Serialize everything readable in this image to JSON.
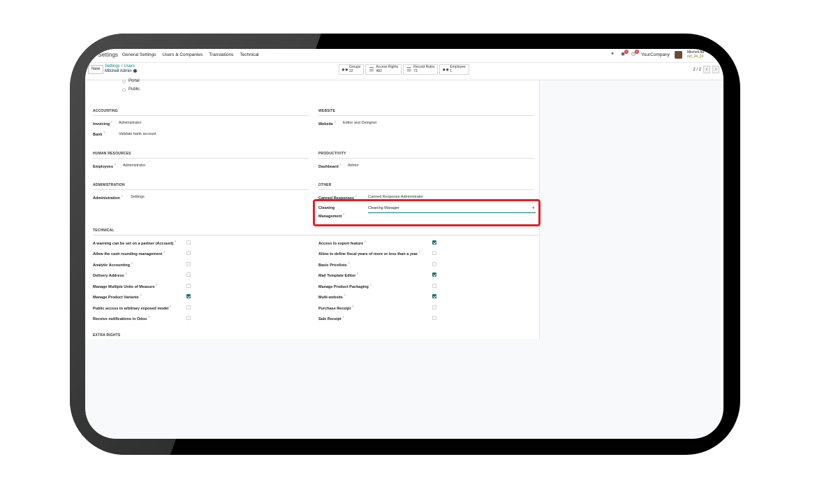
{
  "navbar": {
    "app_name": "Settings",
    "menu": [
      "General Settings",
      "Users & Companies",
      "Translations",
      "Technical"
    ],
    "chat_badge": "5",
    "activity_badge": "6",
    "company": "YourCompany",
    "user_name": "Mitchell Ad",
    "user_db": "oct_24_23"
  },
  "control": {
    "new_label": "New",
    "breadcrumb_parent": "Settings",
    "breadcrumb_sep": "/",
    "breadcrumb_child": "Users",
    "record_name": "Mitchell Admin",
    "stats": [
      {
        "label": "Groups",
        "count": "22"
      },
      {
        "label": "Access Rights",
        "count": "482"
      },
      {
        "label": "Record Rules",
        "count": "73"
      },
      {
        "label": "Employee",
        "count": "1"
      }
    ],
    "pager": "2 / 2"
  },
  "form": {
    "radio_options": [
      "Portal",
      "Public"
    ],
    "sections": {
      "accounting": "ACCOUNTING",
      "website": "WEBSITE",
      "human_resources": "HUMAN RESOURCES",
      "productivity": "PRODUCTIVITY",
      "administration": "ADMINISTRATION",
      "other": "OTHER",
      "technical": "TECHNICAL",
      "extra_rights": "EXTRA RIGHTS"
    },
    "fields": {
      "invoicing_label": "Invoicing",
      "invoicing_value": "Administrator",
      "bank_label": "Bank",
      "bank_value": "Validate bank account",
      "website_label": "Website",
      "website_value": "Editor and Designer",
      "employees_label": "Employees",
      "employees_value": "Administrator",
      "dashboard_label": "Dashboard",
      "dashboard_value": "Admin",
      "administration_label": "Administration",
      "administration_value": "Settings",
      "canned_label": "Canned Responses",
      "canned_value": "Canned Response Administrator",
      "cleaning_label_1": "Cleaning",
      "cleaning_label_2": "Management",
      "cleaning_value": "Cleaning Manager"
    },
    "help_mark": "?",
    "technical_left": [
      {
        "label": "A warning can be set on a partner (Account)",
        "checked": false
      },
      {
        "label": "Allow the cash rounding management",
        "checked": false
      },
      {
        "label": "Analytic Accounting",
        "checked": false
      },
      {
        "label": "Delivery Address",
        "checked": false
      },
      {
        "label": "Manage Multiple Units of Measure",
        "checked": false
      },
      {
        "label": "Manage Product Variants",
        "checked": true
      },
      {
        "label": "Public access to arbitrary exposed model",
        "checked": false
      },
      {
        "label": "Receive notifications in Odoo",
        "checked": false
      }
    ],
    "technical_right": [
      {
        "label": "Access to export feature",
        "checked": true
      },
      {
        "label": "Allow to define fiscal years of more or less than a year",
        "checked": false
      },
      {
        "label": "Basic Pricelists",
        "checked": false
      },
      {
        "label": "Mail Template Editor",
        "checked": true
      },
      {
        "label": "Manage Product Packaging",
        "checked": false
      },
      {
        "label": "Multi-website",
        "checked": true
      },
      {
        "label": "Purchase Receipt",
        "checked": false
      },
      {
        "label": "Sale Receipt",
        "checked": false
      }
    ]
  },
  "colors": {
    "accent": "#017e84",
    "checkbox_on": "#1f6d74",
    "highlight": "#e11f26",
    "badge": "#e0364b"
  }
}
